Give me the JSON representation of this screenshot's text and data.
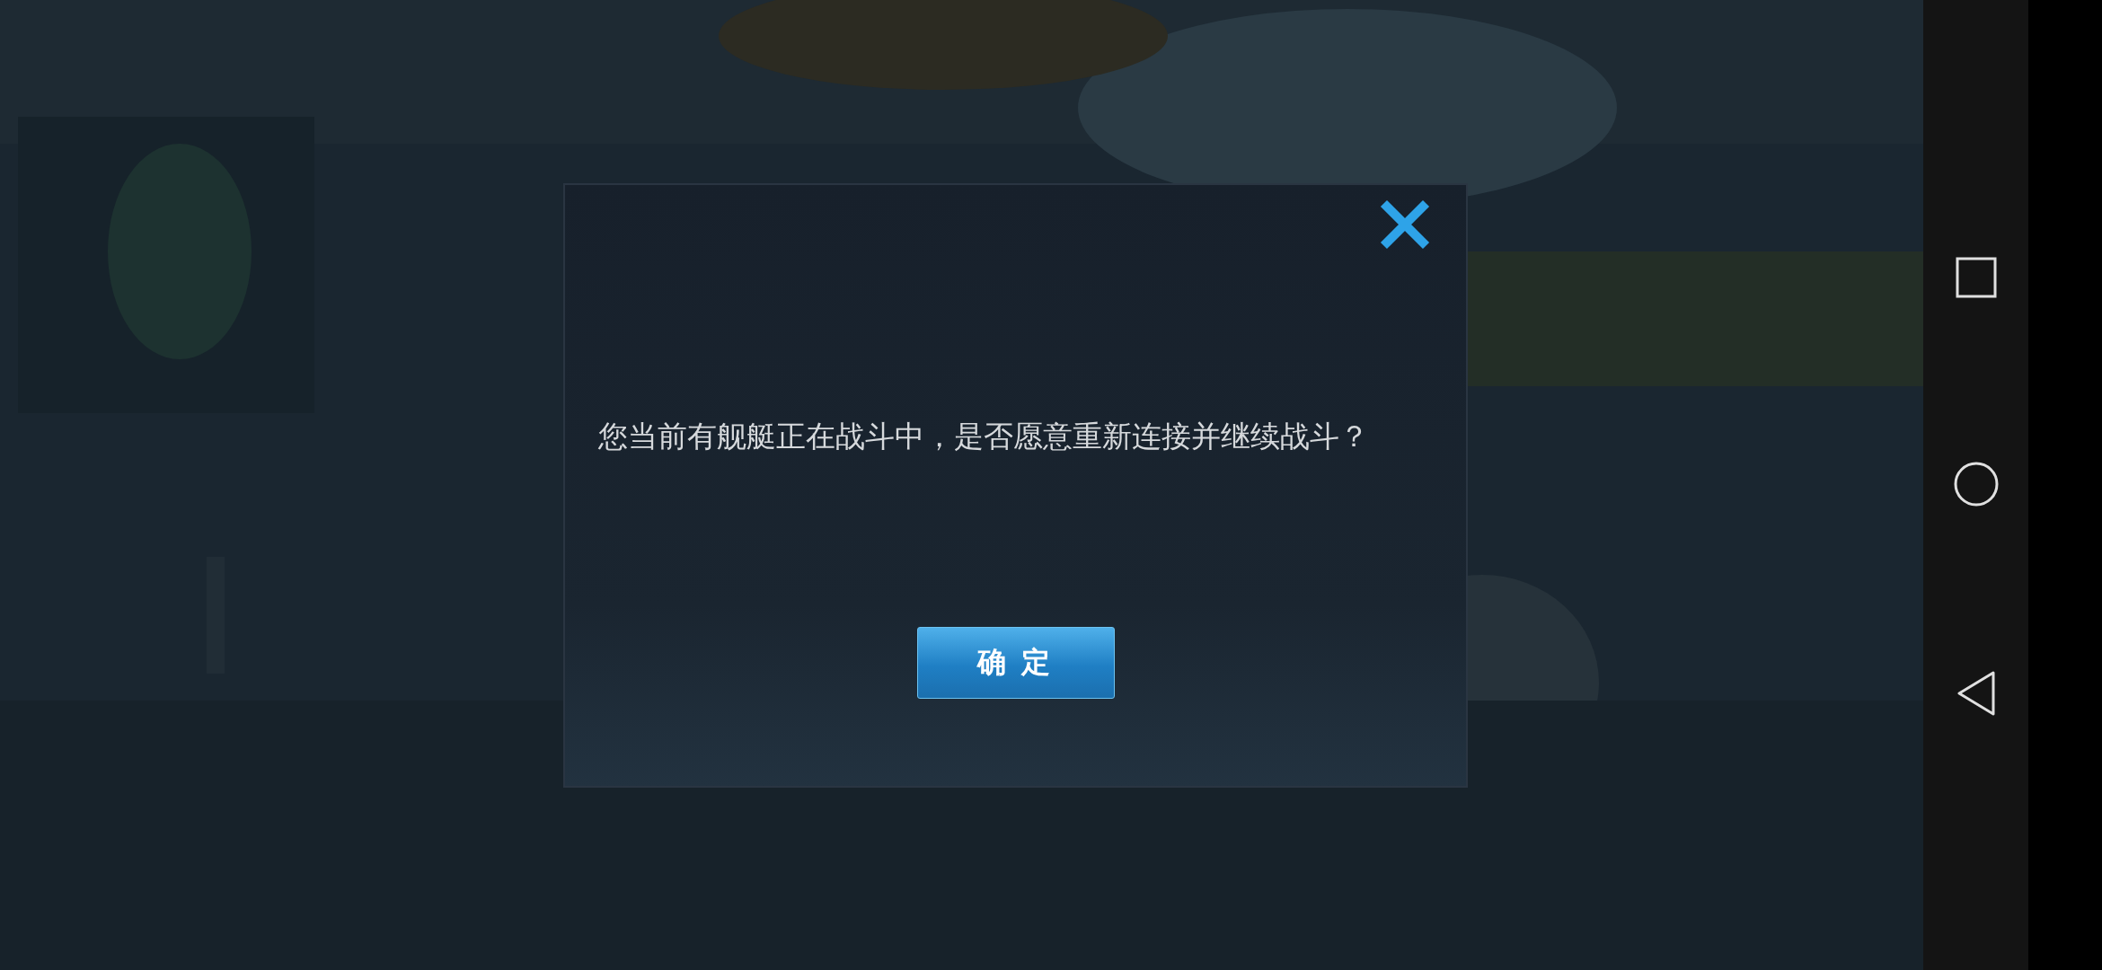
{
  "dialog": {
    "message": "您当前有舰艇正在战斗中，是否愿意重新连接并继续战斗？",
    "confirm_button": "确 定"
  }
}
